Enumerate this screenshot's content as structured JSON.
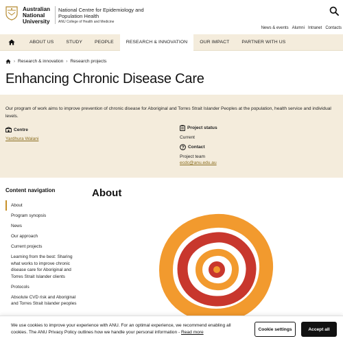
{
  "header": {
    "university_lines": [
      "Australian",
      "National",
      "University"
    ],
    "centre_line1": "National Centre for Epidemiology and",
    "centre_line2": "Population Health",
    "centre_sub": "ANU College of Health and Medicine",
    "search_icon": "search-icon",
    "utility_links": [
      "News & events",
      "Alumni",
      "Intranet",
      "Contacts"
    ]
  },
  "nav": {
    "home_icon": "home-icon",
    "items": [
      "ABOUT US",
      "STUDY",
      "PEOPLE",
      "RESEARCH & INNOVATION",
      "OUR IMPACT",
      "PARTNER WITH US"
    ],
    "active": "RESEARCH & INNOVATION"
  },
  "breadcrumb": {
    "home_icon": "home-icon",
    "items": [
      "Research & innovation",
      "Research projects"
    ]
  },
  "page_title": "Enhancing Chronic Disease Care",
  "info": {
    "intro": "Our program of work aims to improve prevention of chronic disease for Aboriginal and Torres Strait Islander Peoples at the population, health service and individual levels.",
    "centre_label": "Centre",
    "centre_value": "Yardhura Walani",
    "status_label": "Project status",
    "status_value": "Current",
    "contact_label": "Contact",
    "contact_name": "Project team",
    "contact_email": "ecdc@anu.edu.au"
  },
  "content_nav": {
    "title": "Content navigation",
    "items": [
      "About",
      "Program synopsis",
      "News",
      "Our approach",
      "Current projects",
      "Learning from the best: Sharing what works to improve chronic disease care for Aboriginal and Torres Strait Islander clients",
      "Protocols",
      "Absolute CVD risk and Aboriginal and Torres Strait Islander peoples"
    ],
    "current": "About"
  },
  "about_title": "About",
  "cookie": {
    "text": "We use cookies to improve your experience with ANU. For an optimal experience, we recommend enabling all cookies. The ANU Privacy Policy outlines how we handle your personal information - ",
    "link": "Read more",
    "settings_label": "Cookie settings",
    "accept_label": "Accept all"
  },
  "colors": {
    "accent": "#c78f26",
    "panel": "#f4ecdc",
    "art_orange": "#f29a2e",
    "art_red": "#c8372d"
  }
}
